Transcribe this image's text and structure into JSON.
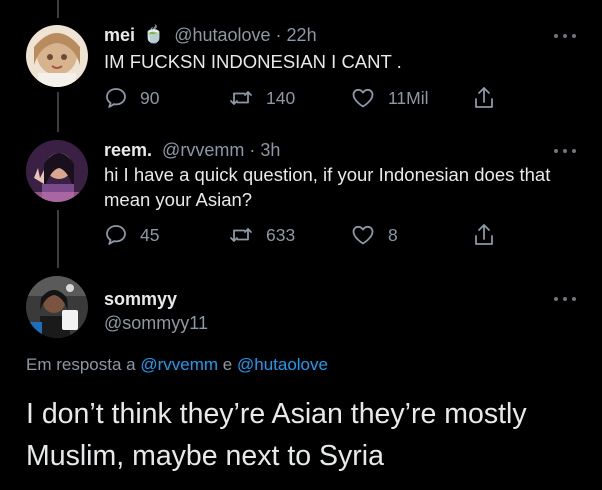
{
  "tweets": [
    {
      "name": "mei",
      "emoji": "🍵",
      "handle": "@hutaolove",
      "separator": "·",
      "time": "22h",
      "text": "IM FUCKSN INDONESIAN I CANT .",
      "replies": "90",
      "retweets": "140",
      "likes": "11Mil",
      "avatar_colors": [
        "#f3e6d8",
        "#c9a98a",
        "#e8cfb4"
      ]
    },
    {
      "name": "reem.",
      "handle": "@rvvemm",
      "separator": "·",
      "time": "3h",
      "text": "hi I have a quick question, if your Indonesian does that mean your Asian?",
      "replies": "45",
      "retweets": "633",
      "likes": "8",
      "avatar_colors": [
        "#3a2140",
        "#d9a8c9",
        "#6a3d7a"
      ]
    }
  ],
  "main_tweet": {
    "name": "sommyy",
    "handle": "@sommyy11",
    "reply_prefix": "Em resposta a",
    "reply_mention_1": "@rvvemm",
    "reply_conjunction": "e",
    "reply_mention_2": "@hutaolove",
    "text": "I don’t think they’re Asian they’re mostly Muslim, maybe next to Syria",
    "avatar_colors": [
      "#2a2a2a",
      "#7a5a45",
      "#1c6fb8"
    ]
  },
  "colors": {
    "background": "#000000",
    "text": "#e7e9ea",
    "secondary": "#8b98a5",
    "link": "#1d9bf0",
    "thread_line": "#3a3d41"
  },
  "icons": [
    "reply-icon",
    "retweet-icon",
    "like-icon",
    "share-icon",
    "more-icon"
  ]
}
